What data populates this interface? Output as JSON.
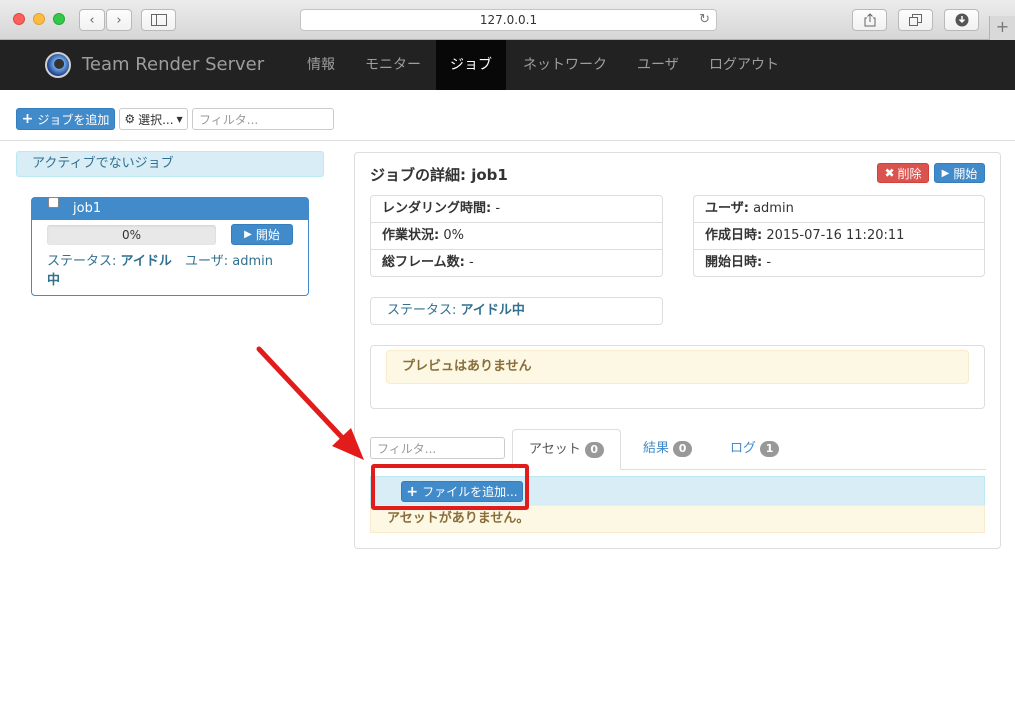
{
  "browser": {
    "url": "127.0.0.1"
  },
  "nav": {
    "brand": "Team Render Server",
    "items": [
      {
        "label": "情報"
      },
      {
        "label": "モニター"
      },
      {
        "label": "ジョブ",
        "active": true
      },
      {
        "label": "ネットワーク"
      },
      {
        "label": "ユーザ"
      },
      {
        "label": "ログアウト"
      }
    ]
  },
  "toolbar": {
    "add_job_label": "ジョブを追加",
    "select_label": "選択...",
    "filter_placeholder": "フィルタ..."
  },
  "inactive_section": {
    "title": "アクティブでないジョブ"
  },
  "job_card": {
    "name": "job1",
    "progress": "0%",
    "progress_fraction": 0,
    "start_label": "開始",
    "status_label": "ステータス:",
    "status_value": "アイドル中",
    "user_label": "ユーザ:",
    "user_value": "admin"
  },
  "details": {
    "title": "ジョブの詳細: job1",
    "delete_label": "削除",
    "start_label": "開始",
    "left_rows": [
      {
        "label": "レンダリング時間:",
        "value": " -"
      },
      {
        "label": "作業状況:",
        "value": " 0%"
      },
      {
        "label": "総フレーム数:",
        "value": " -"
      }
    ],
    "right_rows": [
      {
        "label": "ユーザ:",
        "value": " admin"
      },
      {
        "label": "作成日時:",
        "value": " 2015-07-16 11:20:11"
      },
      {
        "label": "開始日時:",
        "value": " -"
      }
    ],
    "status_label": "ステータス:",
    "status_value": "アイドル中",
    "preview_message": "プレビュはありません"
  },
  "assets": {
    "filter_placeholder": "フィルタ...",
    "tabs": [
      {
        "label": "アセット",
        "count": "0",
        "active": true
      },
      {
        "label": "結果",
        "count": "0"
      },
      {
        "label": "ログ",
        "count": "1"
      }
    ],
    "add_file_label": "ファイルを追加...",
    "empty_message": "アセットがありません。"
  },
  "colors": {
    "primary": "#428bca",
    "danger": "#d9534f",
    "navbar": "#222222",
    "annotation": "#e21b1b"
  }
}
